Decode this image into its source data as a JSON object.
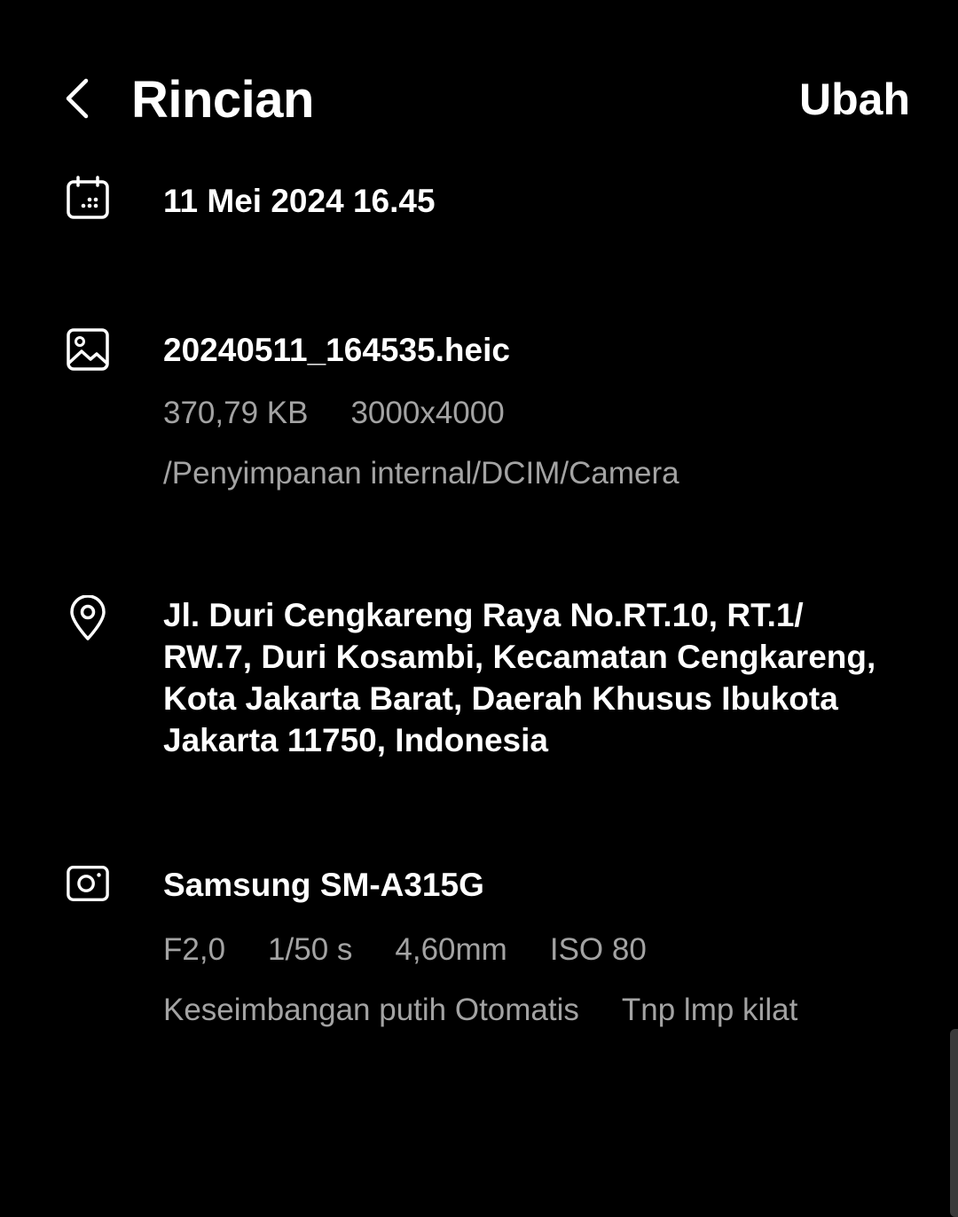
{
  "header": {
    "title": "Rincian",
    "edit_label": "Ubah"
  },
  "date": {
    "icon": "calendar-icon",
    "value": "11 Mei 2024 16.45"
  },
  "file": {
    "icon": "image-icon",
    "name": "20240511_164535.heic",
    "size": "370,79 KB",
    "resolution": "3000x4000",
    "path": "/Penyimpanan internal/DCIM/Camera"
  },
  "location": {
    "icon": "location-pin-icon",
    "address_lines": [
      "Jl. Duri Cengkareng Raya No.RT.10, RT.1/",
      "RW.7, Duri Kosambi, Kecamatan Cengkareng,",
      "Kota Jakarta Barat, Daerah Khusus Ibukota",
      "Jakarta 11750, Indonesia"
    ]
  },
  "camera": {
    "icon": "camera-icon",
    "model": "Samsung SM-A315G",
    "aperture": "F2,0",
    "shutter": "1/50 s",
    "focal_length": "4,60mm",
    "iso": "ISO 80",
    "white_balance": "Keseimbangan putih Otomatis",
    "flash": "Tnp lmp kilat"
  },
  "colors": {
    "background": "#000000",
    "primary_text": "#ffffff",
    "secondary_text": "#a3a3a3"
  }
}
